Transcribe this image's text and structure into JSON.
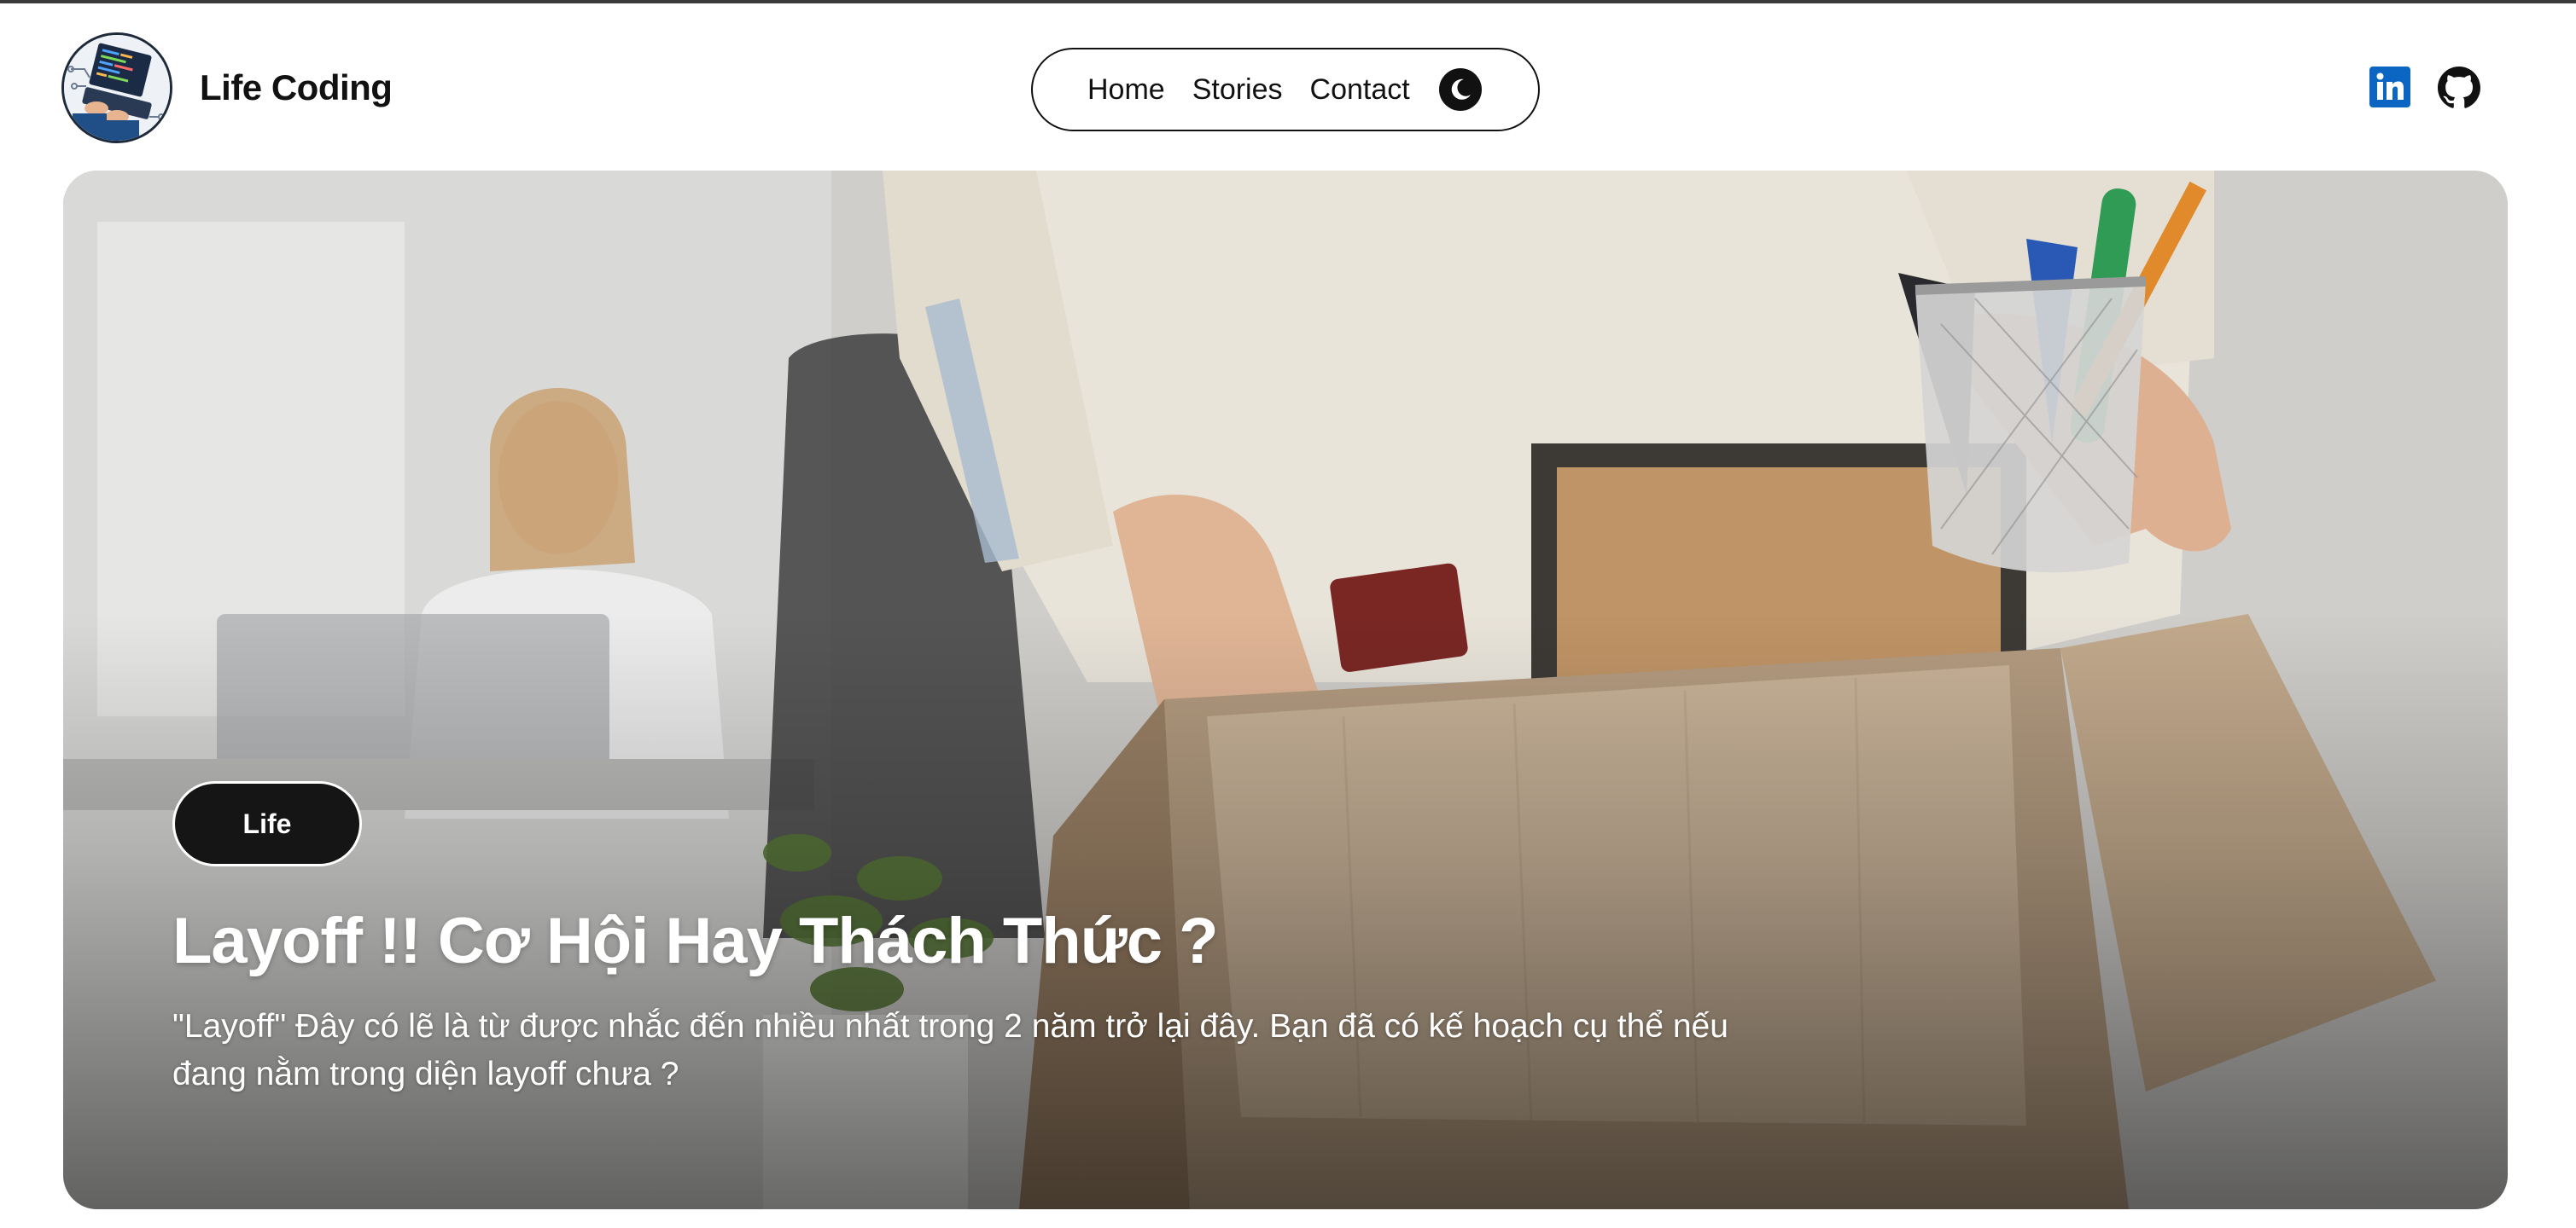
{
  "brand": {
    "name": "Life Coding",
    "logo_icon": "coder-at-laptop-avatar"
  },
  "nav": {
    "items": [
      {
        "label": "Home"
      },
      {
        "label": "Stories"
      },
      {
        "label": "Contact"
      }
    ],
    "theme_toggle_icon": "moon-icon"
  },
  "social": {
    "linkedin_icon": "linkedin-icon",
    "github_icon": "github-icon",
    "linkedin_color": "#0A66C2"
  },
  "hero": {
    "tag": "Life",
    "title": "Layoff !! Cơ Hội Hay Thách Thức ?",
    "description": "\"Layoff\" Đây có lẽ là từ được nhắc đến nhiều nhất trong 2 năm trở lại đây. Bạn đã có kế hoạch cụ thể nếu đang nằm trong diện layoff chưa ?",
    "image_icon": "office-packing-box-photo"
  },
  "colors": {
    "text": "#111111",
    "tag_bg": "#151515",
    "border": "#3a3a3a"
  }
}
